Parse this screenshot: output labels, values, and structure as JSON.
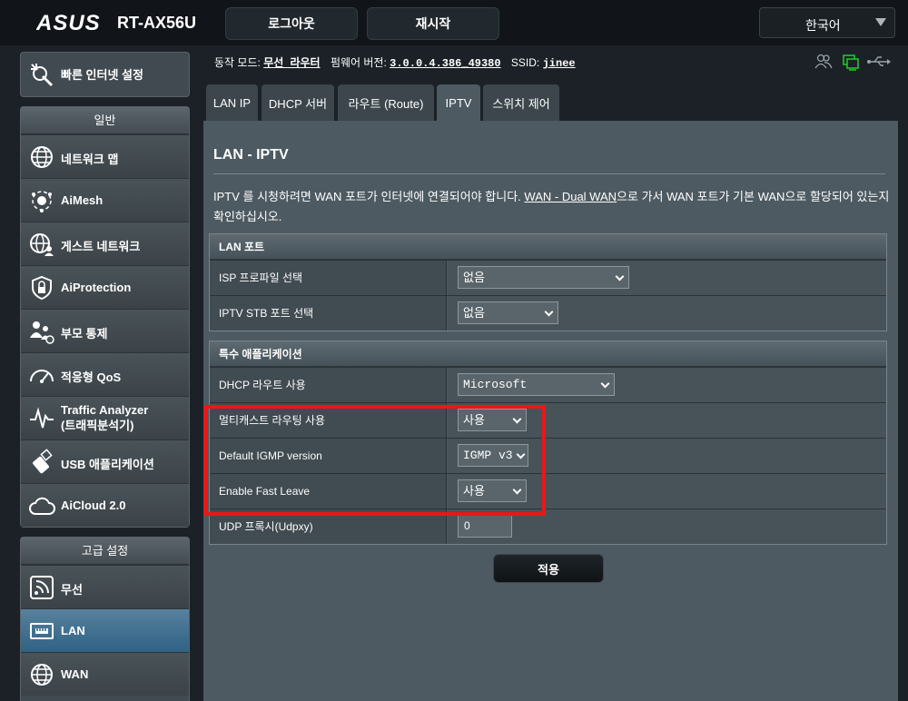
{
  "brand": {
    "logo": "ASUS",
    "model": "RT-AX56U"
  },
  "header": {
    "logout": "로그아웃",
    "reboot": "재시작",
    "language": "한국어"
  },
  "quick_setup": {
    "label": "빠른 인터넷 설정"
  },
  "sidebar_general": {
    "title": "일반",
    "items": [
      {
        "label": "네트워크 맵",
        "icon": "network-map-icon"
      },
      {
        "label": "AiMesh",
        "icon": "aimesh-icon"
      },
      {
        "label": "게스트 네트워크",
        "icon": "guest-network-icon"
      },
      {
        "label": "AiProtection",
        "icon": "aiprotection-icon"
      },
      {
        "label": "부모 통제",
        "icon": "parental-control-icon"
      },
      {
        "label": "적응형 QoS",
        "icon": "qos-icon"
      },
      {
        "label_line1": "Traffic Analyzer",
        "label_line2": "(트래픽분석기)",
        "icon": "traffic-analyzer-icon"
      },
      {
        "label": "USB 애플리케이션",
        "icon": "usb-icon"
      },
      {
        "label": "AiCloud 2.0",
        "icon": "aicloud-icon"
      }
    ]
  },
  "sidebar_advanced": {
    "title": "고급 설정",
    "items": [
      {
        "label": "무선",
        "icon": "wireless-icon"
      },
      {
        "label": "LAN",
        "icon": "lan-icon",
        "active": true
      },
      {
        "label": "WAN",
        "icon": "wan-icon"
      }
    ]
  },
  "status": {
    "mode_label": "동작 모드:",
    "mode_value": "무선 라우터",
    "firmware_label": "펌웨어 버전:",
    "firmware_value": "3.0.0.4.386_49380",
    "ssid_label": "SSID:",
    "ssid_value": "jinee",
    "icons": [
      "clients-icon",
      "network-status-icon",
      "usb-status-icon"
    ]
  },
  "tabs": [
    {
      "label": "LAN IP"
    },
    {
      "label": "DHCP 서버"
    },
    {
      "label": "라우트 (Route)"
    },
    {
      "label": "IPTV",
      "active": true
    },
    {
      "label": "스위치 제어"
    }
  ],
  "page": {
    "title": "LAN - IPTV",
    "desc_before": "IPTV 를 시청하려면 WAN 포트가 인터넷에 연결되어야 합니다. ",
    "desc_link": "WAN - Dual WAN",
    "desc_after": "으로 가서 WAN 포트가 기본 WAN으로 할당되어 있는지 확인하십시오."
  },
  "lan_port": {
    "header": "LAN 포트",
    "rows": [
      {
        "label": "ISP 프로파일 선택",
        "value": "없음"
      },
      {
        "label": "IPTV STB 포트 선택",
        "value": "없음"
      }
    ]
  },
  "special_apps": {
    "header": "특수 애플리케이션",
    "rows": [
      {
        "label": "DHCP 라우트 사용",
        "value": "Microsoft"
      },
      {
        "label": "멀티캐스트 라우팅 사용",
        "value": "사용"
      },
      {
        "label": "Default IGMP version",
        "value": "IGMP v3"
      },
      {
        "label": "Enable Fast Leave",
        "value": "사용"
      },
      {
        "label": "UDP 프록시(Udpxy)",
        "value": "0"
      }
    ]
  },
  "apply_button": "적용",
  "colors": {
    "highlight": "#e8171a",
    "accent_active": "#2f6284",
    "panel": "#4d5a61"
  }
}
